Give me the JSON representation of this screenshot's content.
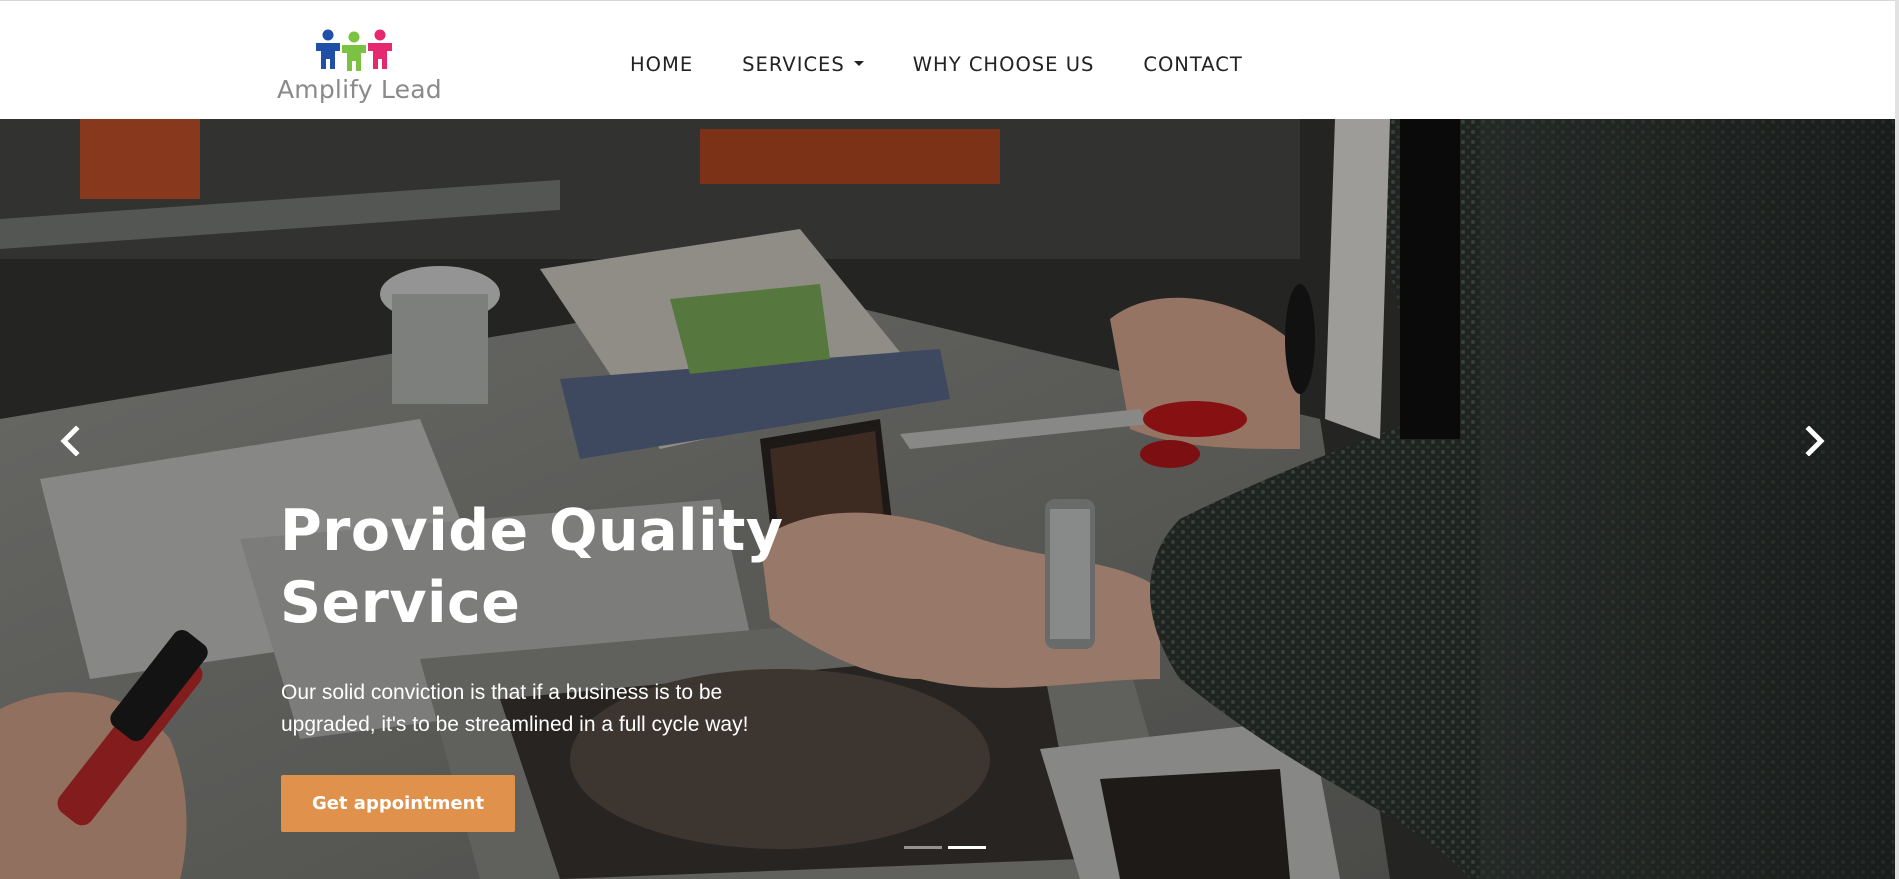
{
  "brand": {
    "name": "Amplify Lead",
    "colors": {
      "figure_blue": "#1f4fa6",
      "figure_green": "#7cc242",
      "figure_pink": "#e5286f"
    }
  },
  "nav": {
    "items": [
      {
        "label": "HOME",
        "has_dropdown": false
      },
      {
        "label": "SERVICES",
        "has_dropdown": true
      },
      {
        "label": "WHY CHOOSE US",
        "has_dropdown": false
      },
      {
        "label": "CONTACT",
        "has_dropdown": false
      }
    ]
  },
  "hero": {
    "title_line1": "Provide Quality",
    "title_line2": "Service",
    "subtitle_line1": "Our solid conviction is that if a business is to be",
    "subtitle_line2": "upgraded, it's to be streamlined in a full cycle way!",
    "cta_label": "Get appointment",
    "cta_color": "#e0924d",
    "prev_icon": "chevron-left-icon",
    "next_icon": "chevron-right-icon",
    "slide_count": 2,
    "active_slide": 2
  }
}
